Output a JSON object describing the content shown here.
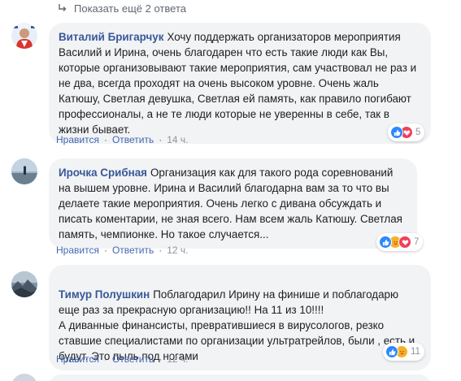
{
  "more_replies": {
    "label": "Показать ещё 2 ответа"
  },
  "comments": [
    {
      "author": "Виталий Бригарчук",
      "text": "Хочу поддержать организаторов мероприятия Василий и Ирина, очень благодарен что есть такие люди как Вы, которые организовывают такие мероприятия, сам участвовал не раз и не два, всегда проходят на очень высоком уровне. Очень жаль Катюшу, Светлая девушка, Светлая ей память, как правило погибают профессионалы, а не те люди которые не уверенны в себе, так в жизни бывает.",
      "reply_label": "Ответить",
      "like_label": "Нравится",
      "time": "14 ч.",
      "reaction_count": "5",
      "reactions": [
        "like-icon",
        "love-icon"
      ]
    },
    {
      "author": "Ирочка Срибная",
      "text": "Организация как для такого рода соревнований на вышем уровне. Ирина и Василий благодарна вам за то что вы делаете такие мероприятия. Очень легко с дивана обсуждать и писать коментарии, не зная всего. Нам всем жаль Катюшу. Светлая память, чемпионке. Но такое случается...",
      "reply_label": "Ответить",
      "like_label": "Нравится",
      "time": "12 ч.",
      "reaction_count": "7",
      "reactions": [
        "like-icon",
        "care-icon",
        "love-icon"
      ]
    },
    {
      "author": "Тимур Полушкин",
      "text": "Поблагодарил Ирину на финише и поблагодарю еще раз за прекрасную организацию!! На 11 из 10!!!!\nА диванные финансисты, превратившиеся в вирусологов, резко ставшие специалистами по организации ультратрейлов, были , есть и будут. Это пыль под ногами",
      "reply_label": "Ответить",
      "like_label": "Нравится",
      "time": "12 ч.",
      "reaction_count": "11",
      "reactions": [
        "like-icon",
        "care-icon"
      ]
    }
  ],
  "colors": {
    "author": "#385898",
    "link": "#4267b2",
    "bubble": "#f2f3f5",
    "like": "#2d88ff",
    "love": "#f33e58",
    "care": "#f7b125"
  }
}
